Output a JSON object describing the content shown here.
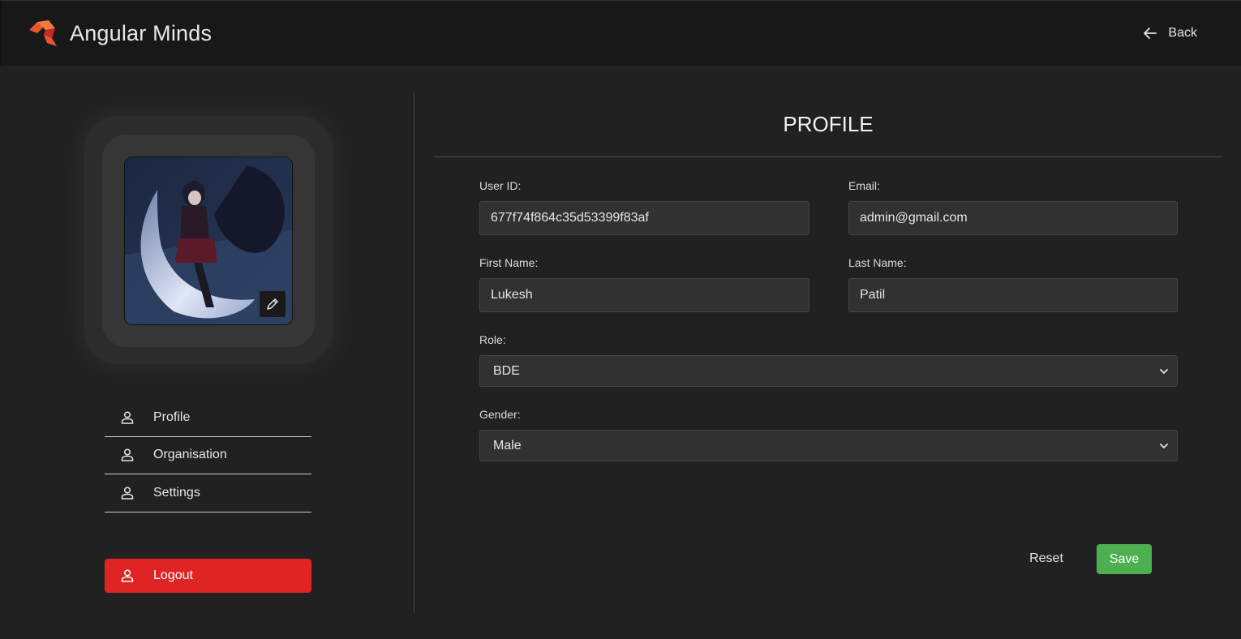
{
  "header": {
    "brand": "Angular Minds",
    "back_label": "Back"
  },
  "sidebar": {
    "items": [
      {
        "label": "Profile",
        "icon": "user-icon"
      },
      {
        "label": "Organisation",
        "icon": "user-icon"
      },
      {
        "label": "Settings",
        "icon": "user-icon"
      }
    ],
    "logout_label": "Logout"
  },
  "form": {
    "title": "PROFILE",
    "user_id": {
      "label": "User ID:",
      "value": "677f74f864c35d53399f83af"
    },
    "email": {
      "label": "Email:",
      "value": "admin@gmail.com"
    },
    "first_name": {
      "label": "First Name:",
      "value": "Lukesh"
    },
    "last_name": {
      "label": "Last Name:",
      "value": "Patil"
    },
    "role": {
      "label": "Role:",
      "value": "BDE"
    },
    "gender": {
      "label": "Gender:",
      "value": "Male"
    },
    "reset_label": "Reset",
    "save_label": "Save"
  },
  "colors": {
    "background": "#212121",
    "topbar": "#181818",
    "logout": "#e02424",
    "save": "#4caf50",
    "logo_orange": "#e8572a",
    "logo_red": "#c62828"
  }
}
